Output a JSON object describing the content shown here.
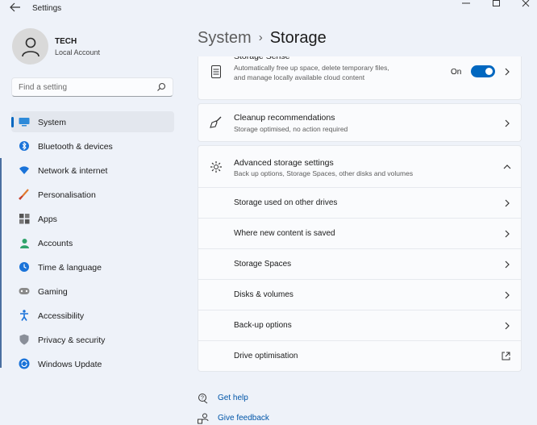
{
  "window": {
    "title": "Settings"
  },
  "profile": {
    "name": "TECH",
    "account_type": "Local Account"
  },
  "search": {
    "placeholder": "Find a setting"
  },
  "nav": {
    "items": [
      {
        "label": "System",
        "icon": "system-display-icon",
        "active": true
      },
      {
        "label": "Bluetooth & devices",
        "icon": "bluetooth-icon"
      },
      {
        "label": "Network & internet",
        "icon": "wifi-icon"
      },
      {
        "label": "Personalisation",
        "icon": "paintbrush-icon"
      },
      {
        "label": "Apps",
        "icon": "apps-grid-icon"
      },
      {
        "label": "Accounts",
        "icon": "person-icon"
      },
      {
        "label": "Time & language",
        "icon": "globe-clock-icon"
      },
      {
        "label": "Gaming",
        "icon": "gamepad-icon"
      },
      {
        "label": "Accessibility",
        "icon": "accessibility-icon"
      },
      {
        "label": "Privacy & security",
        "icon": "shield-icon"
      },
      {
        "label": "Windows Update",
        "icon": "sync-icon"
      }
    ]
  },
  "breadcrumb": {
    "parent": "System",
    "separator": "›",
    "current": "Storage"
  },
  "cards": {
    "storage_sense": {
      "title": "Storage Sense",
      "description": "Automatically free up space, delete temporary files, and manage locally available cloud content",
      "toggle_label": "On",
      "toggle_on": true
    },
    "cleanup": {
      "title": "Cleanup recommendations",
      "description": "Storage optimised, no action required"
    },
    "advanced": {
      "title": "Advanced storage settings",
      "description": "Back up options, Storage Spaces, other disks and volumes",
      "expanded": true,
      "rows": [
        {
          "label": "Storage used on other drives",
          "icon": "chevron-right-icon"
        },
        {
          "label": "Where new content is saved",
          "icon": "chevron-right-icon"
        },
        {
          "label": "Storage Spaces",
          "icon": "chevron-right-icon"
        },
        {
          "label": "Disks & volumes",
          "icon": "chevron-right-icon"
        },
        {
          "label": "Back-up options",
          "icon": "chevron-right-icon"
        },
        {
          "label": "Drive optimisation",
          "icon": "external-link-icon"
        }
      ]
    }
  },
  "links": {
    "help": "Get help",
    "feedback": "Give feedback"
  },
  "colors": {
    "accent": "#0067c0",
    "background": "#eef2f9",
    "card": "#fafbfd",
    "link": "#0055a8"
  }
}
